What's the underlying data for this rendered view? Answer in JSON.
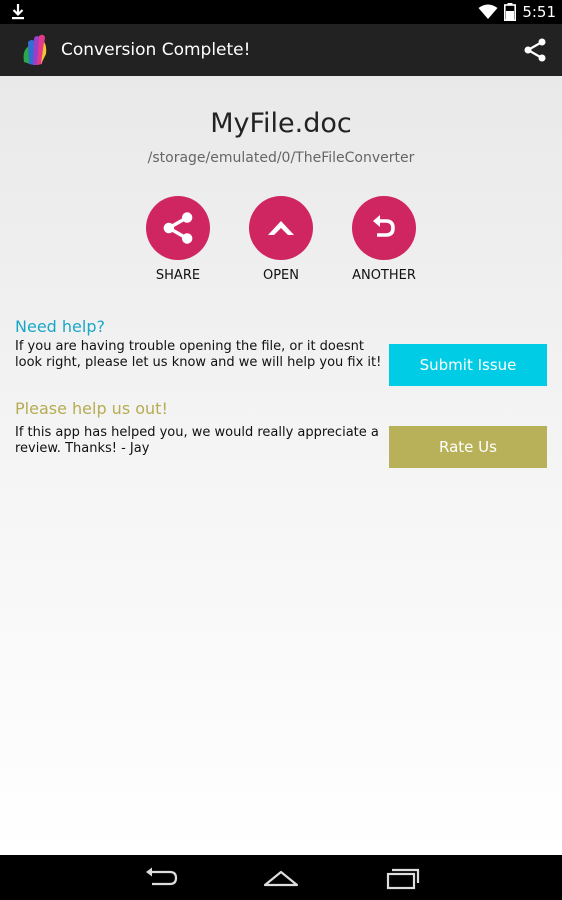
{
  "status_bar": {
    "time": "5:51"
  },
  "action_bar": {
    "title": "Conversion Complete!"
  },
  "file": {
    "name": "MyFile.doc",
    "path": "/storage/emulated/0/TheFileConverter"
  },
  "actions": [
    {
      "label": "SHARE",
      "icon": "share-icon"
    },
    {
      "label": "OPEN",
      "icon": "chevron-up-icon"
    },
    {
      "label": "ANOTHER",
      "icon": "undo-icon"
    }
  ],
  "help": {
    "title": "Need help?",
    "text": "If you are having trouble opening the file, or it doesnt look right, please let us know and we will help you fix it!",
    "button": "Submit Issue",
    "title_color": "#1aa7c7",
    "button_color": "#00cde5"
  },
  "review": {
    "title": "Please help us out!",
    "text": "If this app has helped you, we would really appreciate a review. Thanks! - Jay",
    "button": "Rate Us",
    "title_color": "#b6ac52",
    "button_color": "#b9b15a"
  },
  "colors": {
    "accent": "#cf2662",
    "action_bar": "#222222"
  }
}
